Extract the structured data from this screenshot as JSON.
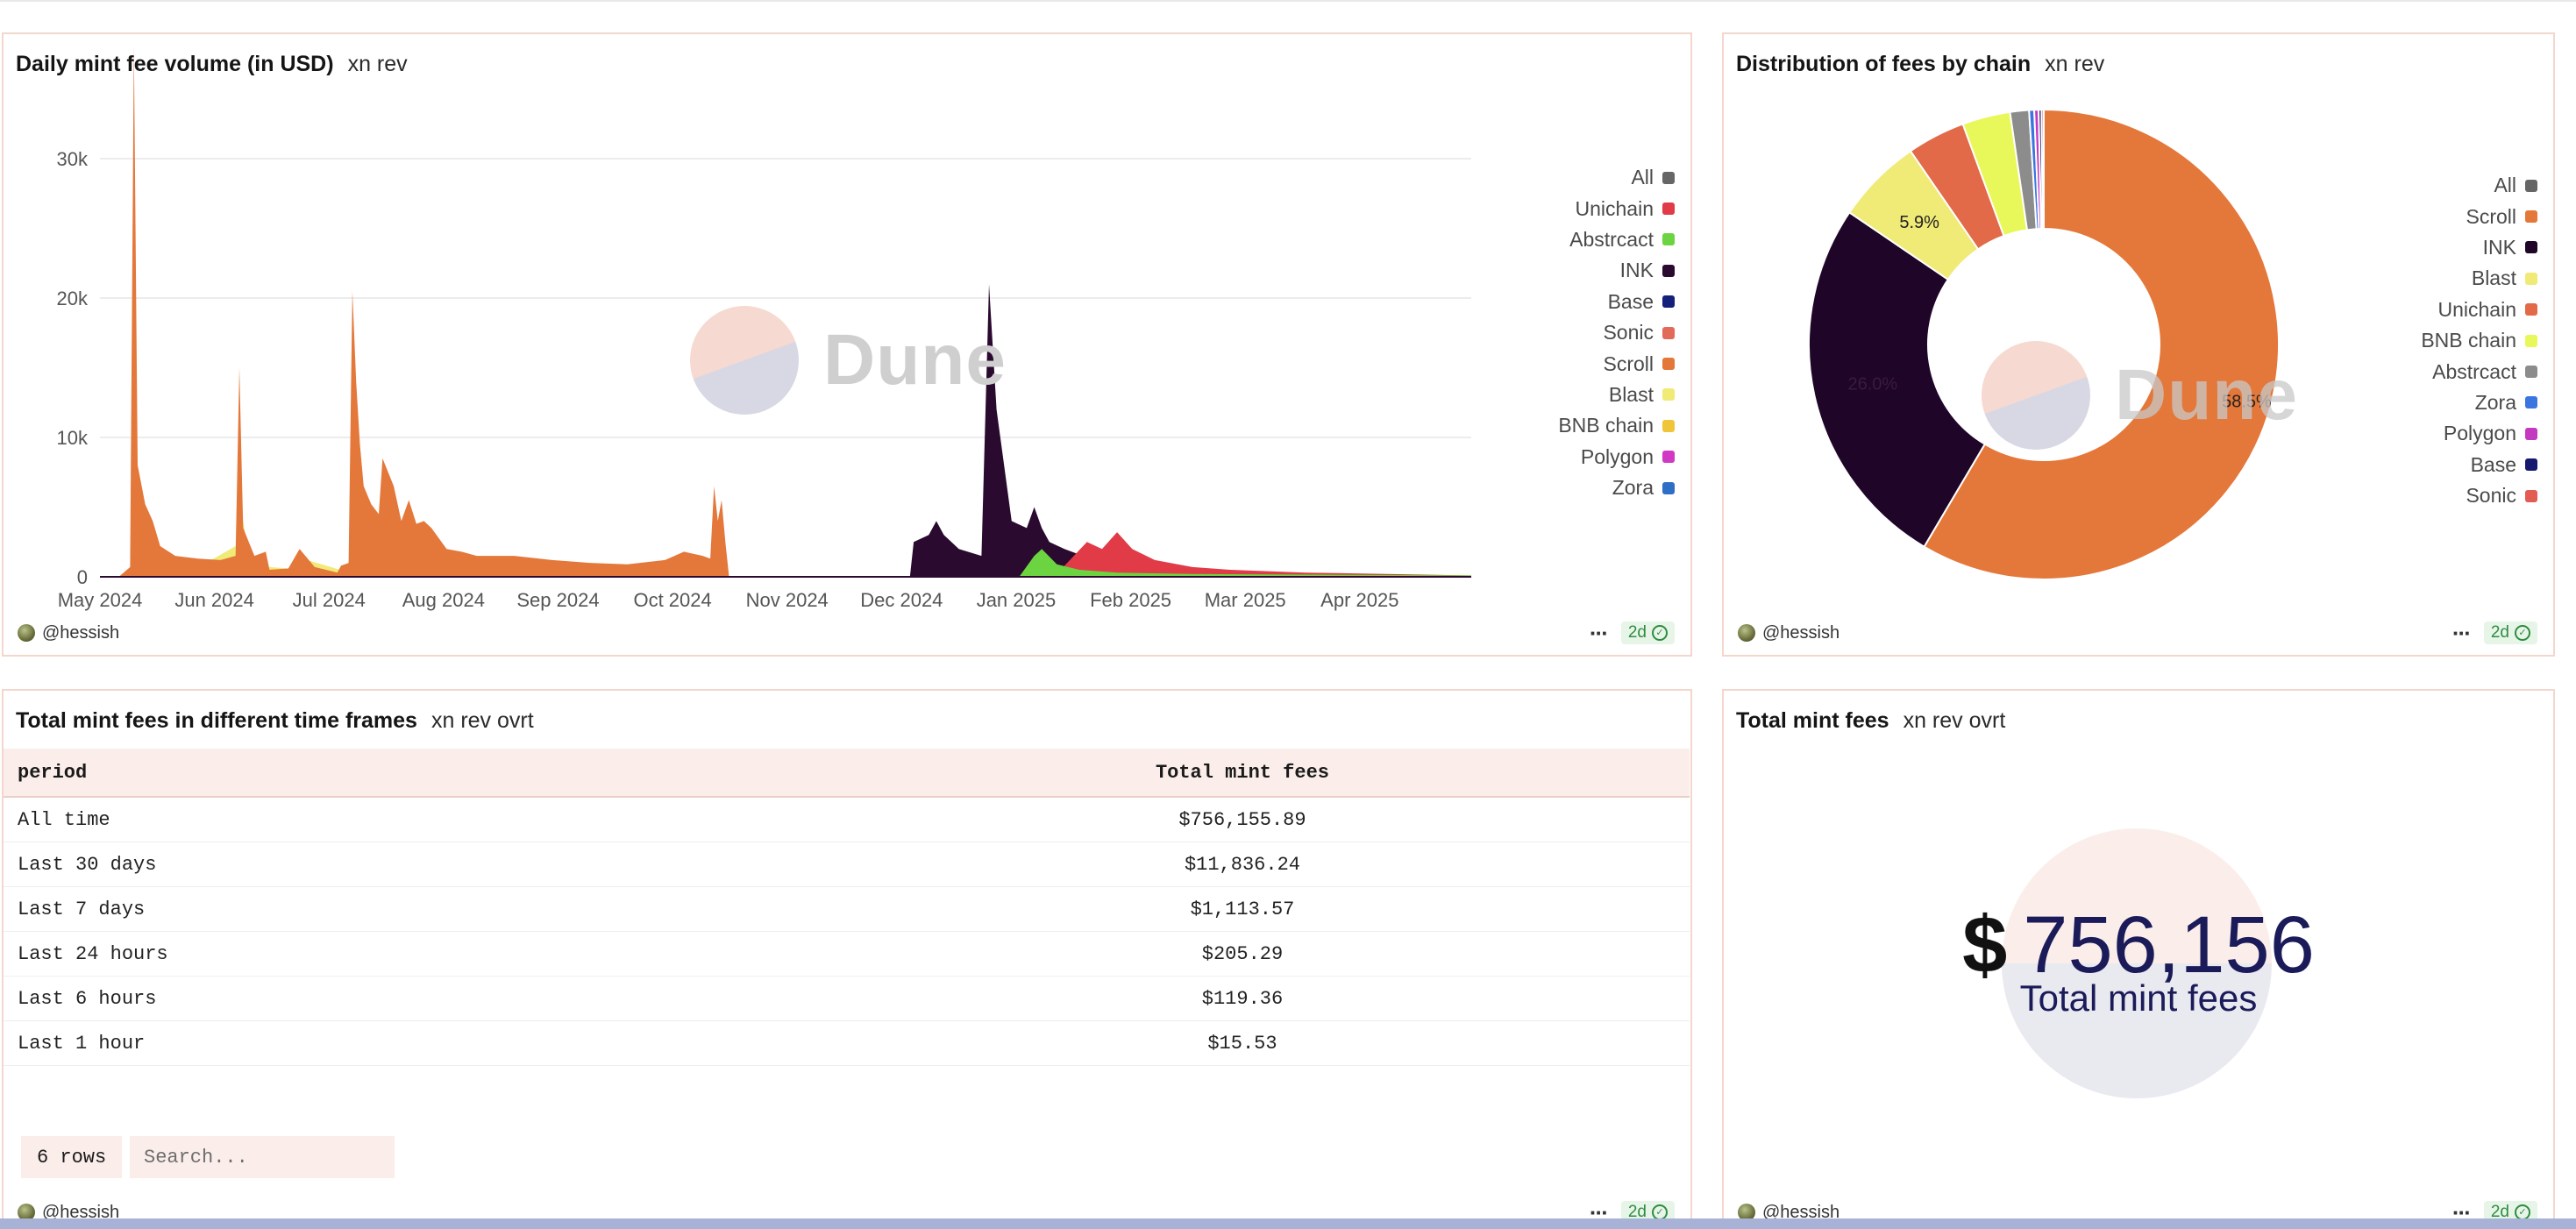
{
  "panels": {
    "daily": {
      "title": "Daily mint fee volume (in USD)",
      "subtitle": "xn rev"
    },
    "distribution": {
      "title": "Distribution of fees by chain",
      "subtitle": "xn rev"
    },
    "timeframes": {
      "title": "Total mint fees in different time frames",
      "subtitle": "xn rev ovrt"
    },
    "total": {
      "title": "Total mint fees",
      "subtitle": "xn rev ovrt"
    }
  },
  "footer": {
    "author": "@hessish",
    "age": "2d"
  },
  "watermark": "Dune",
  "legend_daily": [
    {
      "label": "All",
      "color": "#666666"
    },
    {
      "label": "Unichain",
      "color": "#e03b47"
    },
    {
      "label": "Abstrcact",
      "color": "#6cd341"
    },
    {
      "label": "INK",
      "color": "#2a0a2f"
    },
    {
      "label": "Base",
      "color": "#15207d"
    },
    {
      "label": "Sonic",
      "color": "#e26a58"
    },
    {
      "label": "Scroll",
      "color": "#e4773a"
    },
    {
      "label": "Blast",
      "color": "#f0ea76"
    },
    {
      "label": "BNB chain",
      "color": "#f0c53a"
    },
    {
      "label": "Polygon",
      "color": "#d138c4"
    },
    {
      "label": "Zora",
      "color": "#2f6ec6"
    }
  ],
  "legend_pie": [
    {
      "label": "All",
      "color": "#666666"
    },
    {
      "label": "Scroll",
      "color": "#e4773a"
    },
    {
      "label": "INK",
      "color": "#1f0528"
    },
    {
      "label": "Blast",
      "color": "#f0ea76"
    },
    {
      "label": "Unichain",
      "color": "#e26a48"
    },
    {
      "label": "BNB chain",
      "color": "#e8f85a"
    },
    {
      "label": "Abstrcact",
      "color": "#8c8c8c"
    },
    {
      "label": "Zora",
      "color": "#3b76e0"
    },
    {
      "label": "Polygon",
      "color": "#c33ac0"
    },
    {
      "label": "Base",
      "color": "#161a6e"
    },
    {
      "label": "Sonic",
      "color": "#e25b55"
    }
  ],
  "chart_data": [
    {
      "type": "area",
      "title": "Daily mint fee volume (in USD)",
      "x_ticks": [
        "May 2024",
        "Jun 2024",
        "Jul 2024",
        "Aug 2024",
        "Sep 2024",
        "Oct 2024",
        "Nov 2024",
        "Dec 2024",
        "Jan 2025",
        "Feb 2025",
        "Mar 2025",
        "Apr 2025"
      ],
      "y_ticks": [
        "0",
        "10k",
        "20k",
        "30k"
      ],
      "ylim": [
        0,
        40000
      ],
      "x_range": [
        "2024-05-01",
        "2025-04-30"
      ],
      "series": [
        {
          "name": "Blast",
          "values": [
            [
              5,
              0
            ],
            [
              10,
              300
            ],
            [
              25,
              500
            ],
            [
              36,
              2200
            ],
            [
              37,
              12000
            ],
            [
              38,
              4000
            ],
            [
              40,
              800
            ],
            [
              50,
              600
            ],
            [
              55,
              1200
            ],
            [
              65,
              400
            ],
            [
              80,
              300
            ],
            [
              100,
              200
            ],
            [
              130,
              150
            ],
            [
              170,
              50
            ],
            [
              185,
              0
            ]
          ]
        },
        {
          "name": "Scroll",
          "values": [
            [
              5,
              0
            ],
            [
              8,
              700
            ],
            [
              9,
              38000
            ],
            [
              10,
              8000
            ],
            [
              12,
              5200
            ],
            [
              14,
              4000
            ],
            [
              16,
              2200
            ],
            [
              20,
              1500
            ],
            [
              26,
              1300
            ],
            [
              32,
              1200
            ],
            [
              36,
              1500
            ],
            [
              37,
              15000
            ],
            [
              38,
              3500
            ],
            [
              41,
              1500
            ],
            [
              44,
              1800
            ],
            [
              45,
              500
            ],
            [
              50,
              600
            ],
            [
              53,
              2000
            ],
            [
              57,
              700
            ],
            [
              63,
              300
            ],
            [
              64,
              800
            ],
            [
              65,
              900
            ],
            [
              66,
              1000
            ],
            [
              67,
              20500
            ],
            [
              68,
              14000
            ],
            [
              69,
              9500
            ],
            [
              70,
              6500
            ],
            [
              72,
              5200
            ],
            [
              74,
              4500
            ],
            [
              75,
              8500
            ],
            [
              78,
              6500
            ],
            [
              80,
              4000
            ],
            [
              82,
              5500
            ],
            [
              84,
              3800
            ],
            [
              86,
              4000
            ],
            [
              88,
              3500
            ],
            [
              92,
              2000
            ],
            [
              96,
              1800
            ],
            [
              100,
              1500
            ],
            [
              110,
              1500
            ],
            [
              120,
              1200
            ],
            [
              130,
              1000
            ],
            [
              140,
              900
            ],
            [
              150,
              1200
            ],
            [
              155,
              1800
            ],
            [
              160,
              1500
            ],
            [
              162,
              1300
            ],
            [
              163,
              6500
            ],
            [
              164,
              4000
            ],
            [
              165,
              5500
            ],
            [
              166,
              2500
            ],
            [
              167,
              0
            ],
            [
              230,
              0
            ],
            [
              250,
              0
            ],
            [
              320,
              0
            ],
            [
              364,
              0
            ]
          ]
        },
        {
          "name": "INK",
          "values": [
            [
              200,
              0
            ],
            [
              215,
              0
            ],
            [
              216,
              2500
            ],
            [
              220,
              3000
            ],
            [
              222,
              4000
            ],
            [
              224,
              3000
            ],
            [
              226,
              2500
            ],
            [
              228,
              2000
            ],
            [
              234,
              1500
            ],
            [
              236,
              21000
            ],
            [
              238,
              12000
            ],
            [
              240,
              8000
            ],
            [
              242,
              4000
            ],
            [
              246,
              3500
            ],
            [
              248,
              5000
            ],
            [
              250,
              3500
            ],
            [
              252,
              2500
            ],
            [
              256,
              2000
            ],
            [
              260,
              1600
            ],
            [
              265,
              1200
            ],
            [
              270,
              900
            ],
            [
              280,
              700
            ],
            [
              290,
              500
            ],
            [
              300,
              400
            ],
            [
              310,
              300
            ],
            [
              320,
              200
            ],
            [
              364,
              0
            ]
          ]
        },
        {
          "name": "Unichain",
          "values": [
            [
              250,
              0
            ],
            [
              255,
              500
            ],
            [
              262,
              2500
            ],
            [
              266,
              2000
            ],
            [
              270,
              3200
            ],
            [
              274,
              2000
            ],
            [
              280,
              1200
            ],
            [
              290,
              700
            ],
            [
              300,
              500
            ],
            [
              310,
              400
            ],
            [
              320,
              300
            ],
            [
              364,
              100
            ]
          ]
        },
        {
          "name": "Abstrcact",
          "values": [
            [
              244,
              0
            ],
            [
              248,
              1500
            ],
            [
              250,
              2000
            ],
            [
              254,
              900
            ],
            [
              260,
              500
            ],
            [
              270,
              300
            ],
            [
              290,
              200
            ],
            [
              364,
              100
            ]
          ]
        }
      ]
    },
    {
      "type": "pie",
      "title": "Distribution of fees by chain",
      "slices": [
        {
          "label": "Scroll",
          "value": 58.5
        },
        {
          "label": "INK",
          "value": 26.0
        },
        {
          "label": "Blast",
          "value": 5.9
        },
        {
          "label": "Unichain",
          "value": 4.0
        },
        {
          "label": "BNB chain",
          "value": 3.3
        },
        {
          "label": "Abstrcact",
          "value": 1.3
        },
        {
          "label": "Zora",
          "value": 0.35
        },
        {
          "label": "Polygon",
          "value": 0.3
        },
        {
          "label": "Base",
          "value": 0.2
        },
        {
          "label": "Sonic",
          "value": 0.15
        }
      ],
      "data_labels": [
        "58.5%",
        "26.0%",
        "5.9%"
      ]
    },
    {
      "type": "table",
      "title": "Total mint fees in different time frames",
      "columns": [
        "period",
        "Total mint fees"
      ],
      "rows": [
        [
          "All time",
          "$756,155.89"
        ],
        [
          "Last 30 days",
          "$11,836.24"
        ],
        [
          "Last 7 days",
          "$1,113.57"
        ],
        [
          "Last 24 hours",
          "$205.29"
        ],
        [
          "Last 6 hours",
          "$119.36"
        ],
        [
          "Last 1 hour",
          "$15.53"
        ]
      ]
    }
  ],
  "table": {
    "columns": [
      "period",
      "Total mint fees"
    ],
    "rows": [
      {
        "period": "All time",
        "fees": "$756,155.89"
      },
      {
        "period": "Last 30 days",
        "fees": "$11,836.24"
      },
      {
        "period": "Last 7 days",
        "fees": "$1,113.57"
      },
      {
        "period": "Last 24 hours",
        "fees": "$205.29"
      },
      {
        "period": "Last 6 hours",
        "fees": "$119.36"
      },
      {
        "period": "Last 1 hour",
        "fees": "$15.53"
      }
    ],
    "row_count_label": "6 rows",
    "search_placeholder": "Search..."
  },
  "counter": {
    "currency": "$",
    "value": "756,156",
    "label": "Total mint fees"
  }
}
